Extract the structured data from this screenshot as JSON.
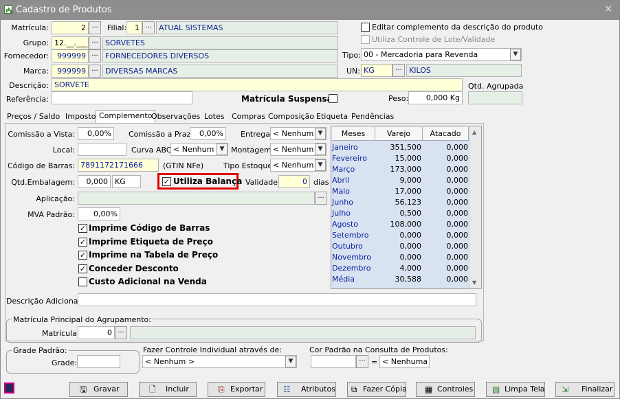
{
  "window": {
    "title": "Cadastro de Produtos",
    "close": "×"
  },
  "header": {
    "matricula_label": "Matrícula:",
    "matricula": "2",
    "filial_label": "Filial:",
    "filial": "1",
    "filial_nome": "ATUAL SISTEMAS",
    "grupo_label": "Grupo:",
    "grupo": "12.__.___",
    "grupo_nome": "SORVETES",
    "fornecedor_label": "Fornecedor:",
    "fornecedor": "999999",
    "fornecedor_nome": "FORNECEDORES DIVERSOS",
    "marca_label": "Marca:",
    "marca": "999999",
    "marca_nome": "DIVERSAS MARCAS",
    "descricao_label": "Descrição:",
    "descricao": "SORVETE",
    "referencia_label": "Referência:",
    "referencia": "",
    "matricula_suspensa_label": "Matrícula Suspensa",
    "editar_complemento_label": "Editar complemento da descrição do produto",
    "controle_lote_label": "Utiliza Controle de Lote/Validade",
    "tipo_label": "Tipo:",
    "tipo": "00 - Mercadoria para Revenda",
    "un_label": "UN:",
    "un": "KG",
    "un_nome": "KILOS",
    "qtd_agrupada_label": "Qtd. Agrupada",
    "peso_label": "Peso:",
    "peso": "0,000 Kg",
    "ellipsis": "..."
  },
  "tabs": [
    "Preços / Saldo",
    "Imposto",
    "Complemento",
    "Observações",
    "Lotes",
    "Compras",
    "Composição",
    "Etiqueta",
    "Pendências"
  ],
  "complemento": {
    "comissao_vista_label": "Comissão a Vista:",
    "comissao_vista": "0,00%",
    "comissao_prazo_label": "Comissão a Prazo:",
    "comissao_prazo": "0,00%",
    "entrega_label": "Entrega:",
    "entrega": "< Nenhum >",
    "local_label": "Local:",
    "local": "",
    "curva_abc_label": "Curva ABC:",
    "curva_abc": "< Nenhum >",
    "montagem_label": "Montagem:",
    "montagem": "< Nenhum >",
    "codigo_barras_label": "Código de Barras:",
    "codigo_barras": "7891172171666",
    "gtin_label": "(GTIN NFe)",
    "tipo_estoque_label": "Tipo Estoque:",
    "tipo_estoque": "< Nenhum >",
    "qtd_embalagem_label": "Qtd.Embalagem:",
    "qtd_embalagem": "0,000",
    "qtd_embalagem_un": "KG",
    "utiliza_balanca_label": "Utiliza Balança",
    "validade_label": "Validade:",
    "validade": "0",
    "dias_label": "dias",
    "aplicacao_label": "Aplicação:",
    "mva_label": "MVA Padrão:",
    "mva": "0,00%",
    "checks": [
      {
        "label": "Imprime Código de Barras",
        "checked": "✓"
      },
      {
        "label": "Imprime Etiqueta de Preço",
        "checked": "✓"
      },
      {
        "label": "Imprime na Tabela de Preço",
        "checked": "✓"
      },
      {
        "label": "Conceder Desconto",
        "checked": "✓"
      },
      {
        "label": "Custo Adicional na Venda",
        "checked": ""
      }
    ],
    "descricao_adicional_label": "Descrição Adicional:",
    "agrupamento_group": "Matrícula Principal do Agrupamento:",
    "agrupamento_matricula_label": "Matrícula:",
    "agrupamento_matricula": "0"
  },
  "meses_table": {
    "headers": [
      "Meses",
      "Varejo",
      "Atacado"
    ],
    "rows": [
      [
        "Janeiro",
        "351,500",
        "0,000"
      ],
      [
        "Fevereiro",
        "15,000",
        "0,000"
      ],
      [
        "Março",
        "173,000",
        "0,000"
      ],
      [
        "Abril",
        "9,000",
        "0,000"
      ],
      [
        "Maio",
        "17,000",
        "0,000"
      ],
      [
        "Junho",
        "56,123",
        "0,000"
      ],
      [
        "Julho",
        "0,500",
        "0,000"
      ],
      [
        "Agosto",
        "108,000",
        "0,000"
      ],
      [
        "Setembro",
        "0,000",
        "0,000"
      ],
      [
        "Outubro",
        "0,000",
        "0,000"
      ],
      [
        "Novembro",
        "0,000",
        "0,000"
      ],
      [
        "Dezembro",
        "4,000",
        "0,000"
      ],
      [
        "Média",
        "30,588",
        "0,000"
      ]
    ]
  },
  "bottom": {
    "grade_group": "Grade Padrão:",
    "grade_label": "Grade:",
    "grade": "",
    "controle_label": "Fazer Controle Individual através de:",
    "controle": "< Nenhum >",
    "cor_label": "Cor Padrão na Consulta de Produtos:",
    "cor_eq": "=",
    "cor": "< Nenhuma >"
  },
  "buttons": [
    {
      "label": "Gravar",
      "icon": "save-icon"
    },
    {
      "label": "Incluir",
      "icon": "new-doc-icon"
    },
    {
      "label": "Exportar",
      "icon": "export-icon"
    },
    {
      "label": "Atributos",
      "icon": "attributes-icon"
    },
    {
      "label": "Fazer Cópia",
      "icon": "copy-icon"
    },
    {
      "label": "Controles",
      "icon": "controls-icon"
    },
    {
      "label": "Limpa Tela",
      "icon": "clear-screen-icon"
    },
    {
      "label": "Finalizar",
      "icon": "exit-icon"
    }
  ],
  "colors": {
    "highlight": "#e00000",
    "accent_field": "#ffffd8",
    "readonly_field": "#e6efe6",
    "table_bg": "#d8e2f0"
  }
}
